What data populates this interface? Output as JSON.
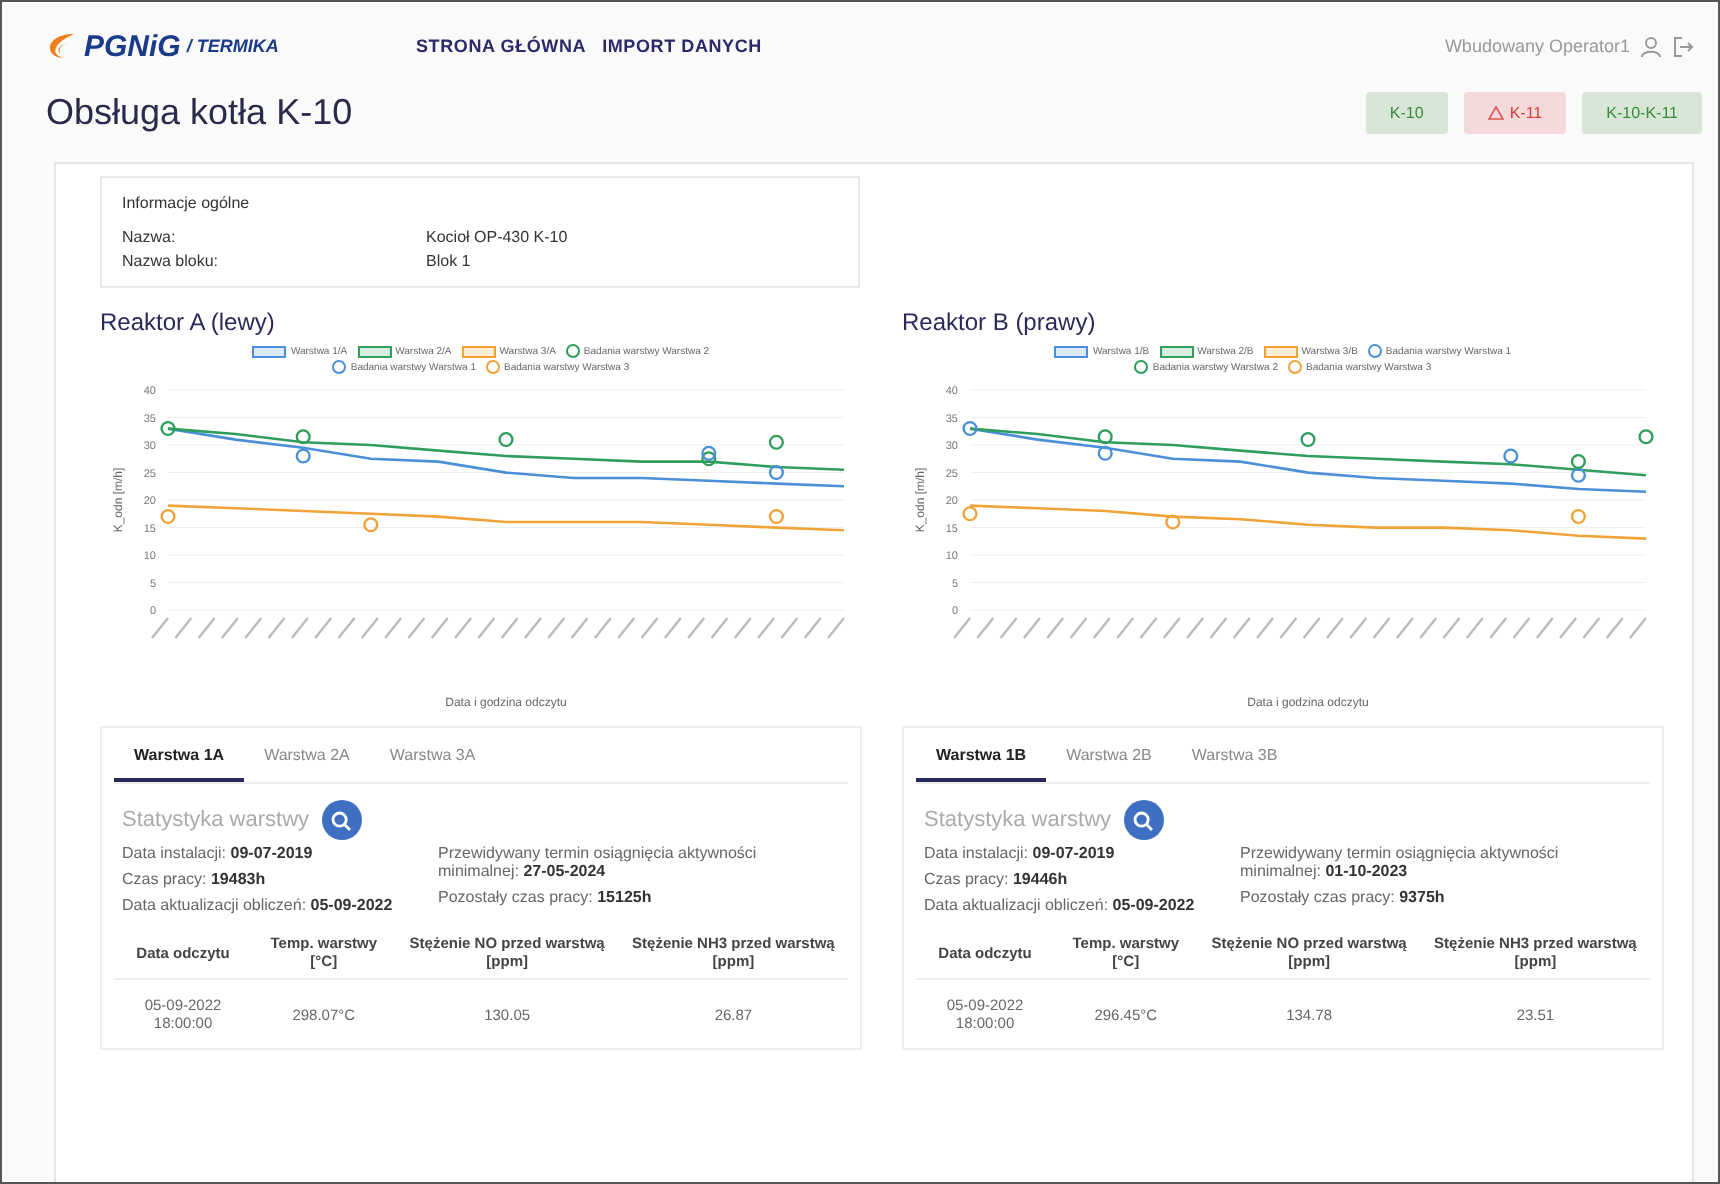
{
  "header": {
    "logo_brand": "PGNiG",
    "logo_sub": "/ TERMIKA",
    "nav": [
      "STRONA GŁÓWNA",
      "IMPORT DANYCH"
    ],
    "user": "Wbudowany Operator1"
  },
  "page_title": "Obsługa kotła K-10",
  "boiler_buttons": [
    {
      "label": "K-10",
      "color": "#3a8a3a",
      "warning": false
    },
    {
      "label": "K-11",
      "color": "#d04040",
      "warning": true
    },
    {
      "label": "K-10-K-11",
      "color": "#3a8a3a",
      "warning": false
    }
  ],
  "general_info": {
    "title": "Informacje ogólne",
    "rows": [
      {
        "label": "Nazwa:",
        "value": "Kocioł OP-430 K-10"
      },
      {
        "label": "Nazwa bloku:",
        "value": "Blok 1"
      }
    ]
  },
  "reactors": [
    {
      "title": "Reaktor A (lewy)",
      "chart_data": {
        "type": "line",
        "grid": true,
        "legend": "top",
        "xlabel": "Data i godzina odczytu",
        "ylabel": "K_odn [m/h]",
        "ylim": [
          0,
          40
        ],
        "yticks": [
          0,
          5,
          10,
          15,
          20,
          25,
          30,
          35,
          40
        ],
        "series": [
          {
            "name": "Warstwa 1/A",
            "color": "#4a8fd8",
            "type": "line",
            "values": [
              33,
              31,
              29.5,
              27.5,
              27,
              25,
              24,
              24,
              23.5,
              23,
              22.5
            ]
          },
          {
            "name": "Warstwa 2/A",
            "color": "#2f9e5c",
            "type": "line",
            "values": [
              33,
              32,
              30.5,
              30,
              29,
              28,
              27.5,
              27,
              27,
              26,
              25.5
            ]
          },
          {
            "name": "Warstwa 3/A",
            "color": "#f0a338",
            "type": "line",
            "values": [
              19,
              18.5,
              18,
              17.5,
              17,
              16,
              16,
              16,
              15.5,
              15,
              14.5
            ]
          },
          {
            "name": "Badania warstwy Warstwa 2",
            "color": "#2f9e5c",
            "type": "scatter",
            "values": [
              33,
              null,
              31.5,
              null,
              null,
              31,
              null,
              null,
              27.5,
              30.5,
              null
            ]
          },
          {
            "name": "Badania warstwy Warstwa 1",
            "color": "#4a8fd8",
            "type": "scatter",
            "values": [
              null,
              null,
              28,
              null,
              null,
              null,
              null,
              null,
              28.5,
              25,
              null
            ]
          },
          {
            "name": "Badania warstwy Warstwa 3",
            "color": "#f0a338",
            "type": "scatter",
            "values": [
              17,
              null,
              null,
              15.5,
              null,
              null,
              null,
              null,
              null,
              17,
              null
            ]
          }
        ]
      },
      "tabs": [
        {
          "label": "Warstwa 1A",
          "selected": true
        },
        {
          "label": "Warstwa 2A",
          "selected": false
        },
        {
          "label": "Warstwa 3A",
          "selected": false
        }
      ],
      "stats_title": "Statystyka warstwy",
      "stats_left": [
        "Data instalacji: **09-07-2019**",
        "Czas pracy: **19483h**",
        "Data aktualizacji obliczeń: **05-09-2022**"
      ],
      "stats_right": [
        "Przewidywany termin osiągnięcia aktywności minimalnej: **27-05-2024**",
        "Pozostały czas pracy: **15125h**"
      ],
      "table": {
        "columns": [
          "Data odczytu",
          "Temp. warstwy [°C]",
          "Stężenie NO przed warstwą [ppm]",
          "Stężenie NH3 przed warstwą [ppm]"
        ],
        "rows": [
          [
            "05-09-2022 18:00:00",
            "298.07°C",
            "130.05",
            "26.87"
          ]
        ]
      }
    },
    {
      "title": "Reaktor B (prawy)",
      "chart_data": {
        "type": "line",
        "grid": true,
        "legend": "top",
        "xlabel": "Data i godzina odczytu",
        "ylabel": "K_odn [m/h]",
        "ylim": [
          0,
          40
        ],
        "yticks": [
          0,
          5,
          10,
          15,
          20,
          25,
          30,
          35,
          40
        ],
        "series": [
          {
            "name": "Warstwa 1/B",
            "color": "#4a8fd8",
            "type": "line",
            "values": [
              33,
              31,
              29.5,
              27.5,
              27,
              25,
              24,
              23.5,
              23,
              22,
              21.5
            ]
          },
          {
            "name": "Warstwa 2/B",
            "color": "#2f9e5c",
            "type": "line",
            "values": [
              33,
              32,
              30.5,
              30,
              29,
              28,
              27.5,
              27,
              26.5,
              25.5,
              24.5
            ]
          },
          {
            "name": "Warstwa 3/B",
            "color": "#f0a338",
            "type": "line",
            "values": [
              19,
              18.5,
              18,
              17,
              16.5,
              15.5,
              15,
              15,
              14.5,
              13.5,
              13
            ]
          },
          {
            "name": "Badania warstwy Warstwa 1",
            "color": "#4a8fd8",
            "type": "scatter",
            "values": [
              33,
              null,
              28.5,
              null,
              null,
              null,
              null,
              null,
              28,
              24.5,
              null
            ]
          },
          {
            "name": "Badania warstwy Warstwa 2",
            "color": "#2f9e5c",
            "type": "scatter",
            "values": [
              null,
              null,
              31.5,
              null,
              null,
              31,
              null,
              null,
              null,
              27,
              31.5
            ]
          },
          {
            "name": "Badania warstwy Warstwa 3",
            "color": "#f0a338",
            "type": "scatter",
            "values": [
              17.5,
              null,
              null,
              16,
              null,
              null,
              null,
              null,
              null,
              17,
              null
            ]
          }
        ]
      },
      "tabs": [
        {
          "label": "Warstwa 1B",
          "selected": true
        },
        {
          "label": "Warstwa 2B",
          "selected": false
        },
        {
          "label": "Warstwa 3B",
          "selected": false
        }
      ],
      "stats_title": "Statystyka warstwy",
      "stats_left": [
        "Data instalacji: **09-07-2019**",
        "Czas pracy: **19446h**",
        "Data aktualizacji obliczeń: **05-09-2022**"
      ],
      "stats_right": [
        "Przewidywany termin osiągnięcia aktywności minimalnej: **01-10-2023**",
        "Pozostały czas pracy: **9375h**"
      ],
      "table": {
        "columns": [
          "Data odczytu",
          "Temp. warstwy [°C]",
          "Stężenie NO przed warstwą [ppm]",
          "Stężenie NH3 przed warstwą [ppm]"
        ],
        "rows": [
          [
            "05-09-2022 18:00:00",
            "296.45°C",
            "134.78",
            "23.51"
          ]
        ]
      }
    }
  ]
}
